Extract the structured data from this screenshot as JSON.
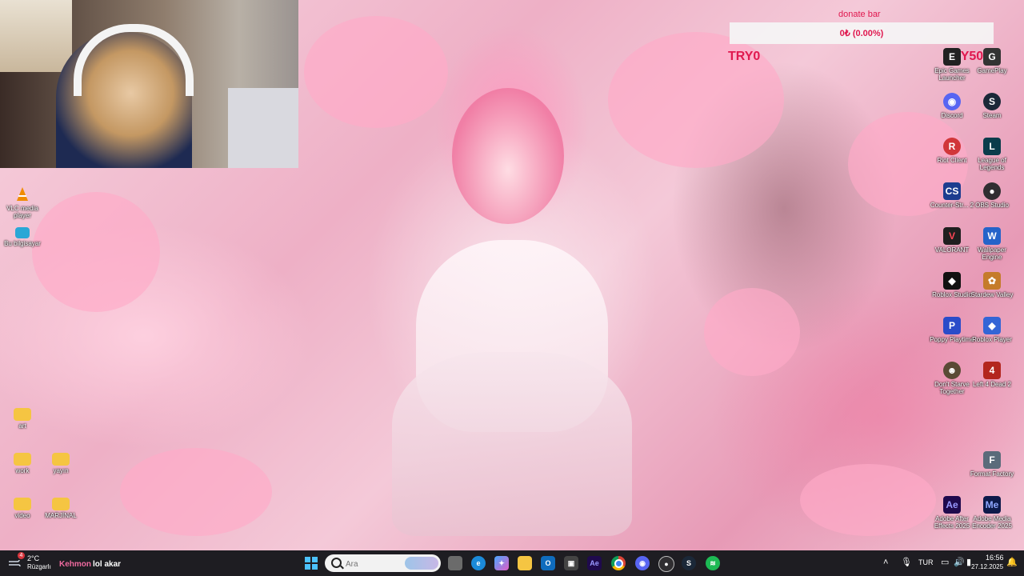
{
  "webcam": {
    "label": "webcam-overlay"
  },
  "donate": {
    "title": "donate bar",
    "progress_text": "0₺ (0.00%)",
    "progress_fraction": 0.0,
    "min_label": "TRY0",
    "max_label": "TRY500",
    "accent_color": "#e0184f"
  },
  "desktop": {
    "left_icons": [
      {
        "label": "VLC media player",
        "icon": "vlc-icon",
        "color": "#f08c00"
      },
      {
        "label": "Bu bilgisayar",
        "icon": "computer-icon",
        "color": "#2aa7d6"
      },
      {
        "label": "art",
        "icon": "folder-icon",
        "color": "#f5c542"
      },
      {
        "label": "work",
        "icon": "folder-icon",
        "color": "#f5c542"
      },
      {
        "label": "yayın",
        "icon": "folder-icon",
        "color": "#f5c542"
      },
      {
        "label": "video",
        "icon": "folder-icon",
        "color": "#f5c542"
      },
      {
        "label": "MARJİNAL",
        "icon": "folder-icon",
        "color": "#f5c542"
      }
    ],
    "right_icons": [
      {
        "label": "Epic Games Launcher",
        "icon": "epic-games-icon",
        "color": "#222222"
      },
      {
        "label": "GamePlay",
        "icon": "gameplay-icon",
        "color": "#333333"
      },
      {
        "label": "Discord",
        "icon": "discord-icon",
        "color": "#5865f2"
      },
      {
        "label": "Steam",
        "icon": "steam-icon",
        "color": "#1b2838"
      },
      {
        "label": "Riot Client",
        "icon": "riot-client-icon",
        "color": "#d13639"
      },
      {
        "label": "League of Legends",
        "icon": "league-of-legends-icon",
        "color": "#0a3c4b"
      },
      {
        "label": "Counter-Str... 2",
        "icon": "counter-strike-icon",
        "color": "#1d3d8f"
      },
      {
        "label": "OBS Studio",
        "icon": "obs-studio-icon",
        "color": "#302e31"
      },
      {
        "label": "VALORANT",
        "icon": "valorant-icon",
        "color": "#1f1f1f"
      },
      {
        "label": "Wallpaper Engine",
        "icon": "wallpaper-engine-icon",
        "color": "#2563c9"
      },
      {
        "label": "Roblox Studio",
        "icon": "roblox-studio-icon",
        "color": "#111111"
      },
      {
        "label": "Stardew Valley",
        "icon": "stardew-valley-icon",
        "color": "#c57b2a"
      },
      {
        "label": "Poppy Playtime",
        "icon": "poppy-playtime-icon",
        "color": "#2a4cc9"
      },
      {
        "label": "Roblox Player",
        "icon": "roblox-player-icon",
        "color": "#3365d6"
      },
      {
        "label": "Don't Starve Together",
        "icon": "dont-starve-icon",
        "color": "#5a4a35"
      },
      {
        "label": "Left 4 Dead 2",
        "icon": "left-4-dead-icon",
        "color": "#b3261e"
      },
      {
        "label": "Format Factory",
        "icon": "format-factory-icon",
        "color": "#5b6b7a"
      },
      {
        "label": "Adobe After Effects 2025",
        "icon": "after-effects-icon",
        "color": "#1f0a4d"
      },
      {
        "label": "Adobe Media Encoder 2025",
        "icon": "media-encoder-icon",
        "color": "#0d1a4a"
      }
    ]
  },
  "taskbar": {
    "weather": {
      "temp": "2°C",
      "desc": "Rüzgarlı",
      "badge": "4"
    },
    "stream_title_a": "Kehmon",
    "stream_title_b": "lol akar",
    "search": {
      "placeholder": "Ara"
    },
    "apps": [
      "start-icon",
      "search-icon",
      "task-view-icon",
      "edge-icon",
      "copilot-icon",
      "file-explorer-icon",
      "outlook-icon",
      "store-icon",
      "after-effects-icon",
      "chrome-icon",
      "discord-icon",
      "obs-icon",
      "steam-icon",
      "spotify-icon"
    ],
    "tray": {
      "language": "TUR",
      "time": "16:56",
      "date": "27.12.2025"
    }
  }
}
